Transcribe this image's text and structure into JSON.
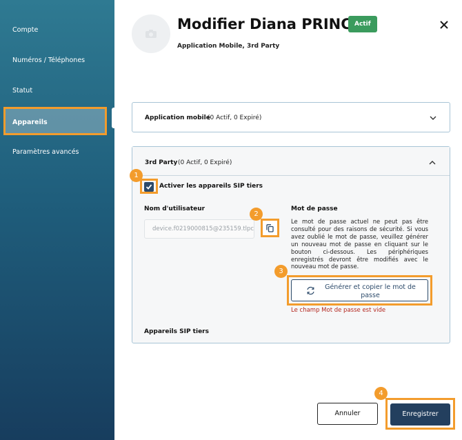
{
  "sidebar": {
    "items": [
      {
        "label": "Compte"
      },
      {
        "label": "Numéros / Téléphones"
      },
      {
        "label": "Statut"
      },
      {
        "label": "Appareils"
      },
      {
        "label": "Paramètres avancés"
      }
    ],
    "active_item": "Appareils"
  },
  "header": {
    "avatar_icon": "camera-icon",
    "title": "Modifier Diana PRINCE",
    "status_badge": "Actif",
    "subtitle": "Application Mobile, 3rd Party",
    "close_icon": "close-icon"
  },
  "panels": {
    "mobile": {
      "title": "Application mobile",
      "counts": "(0 Actif, 0 Expiré)",
      "expanded": false
    },
    "third_party": {
      "title": "3rd Party",
      "counts": "(0 Actif, 0 Expiré)",
      "expanded": true,
      "enable_checkbox_label": "Activer les appareils SIP tiers",
      "enable_checked": true,
      "username_label": "Nom d'utilisateur",
      "username_value": "device.f0219000815@235159.tlpc",
      "password_label": "Mot de passe",
      "password_help": "Le mot de passe actuel ne peut pas être consulté pour des raisons de sécurité. Si vous avez oublié le mot de passe, veuillez générer un nouveau mot de passe en cliquant sur le bouton ci-dessous. Les périphériques enregistrés devront être modifiés avec le nouveau mot de passe.",
      "generate_button": "Générer et copier le mot de passe",
      "password_error": "Le champ Mot de passe est vide",
      "sip_devices_label": "Appareils SIP tiers"
    }
  },
  "markers": [
    "1",
    "2",
    "3",
    "4"
  ],
  "footer": {
    "cancel_label": "Annuler",
    "save_label": "Enregistrer"
  },
  "colors": {
    "accent_orange": "#f39c2c",
    "primary_navy": "#233f5e",
    "status_green": "#3b9b5d",
    "error_red": "#b3261e"
  }
}
